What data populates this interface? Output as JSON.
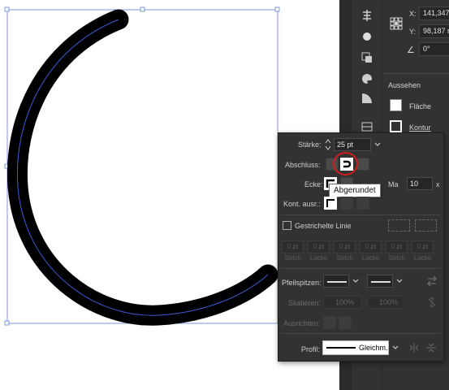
{
  "transform": {
    "x_label": "X:",
    "x_value": "141,347",
    "y_label": "Y:",
    "y_value": "98,187 r",
    "angle_value": "0°"
  },
  "appearance": {
    "title": "Aussehen",
    "fill_label": "Fläche",
    "stroke_label": "Kontur"
  },
  "stroke_panel": {
    "weight_label": "Stärke:",
    "weight_value": "25 pt",
    "cap_label": "Abschluss:",
    "corner_label": "Ecke:",
    "limit_label": "Ma",
    "limit_value": "10",
    "limit_unit": "x",
    "align_label": "Kont. ausr.:",
    "dashed_label": "Gestrichelte Linie",
    "dash_values": [
      "0 pt",
      "0 pt",
      "0 pt",
      "0 pt",
      "0 pt",
      "0 pt"
    ],
    "dash_labels": [
      "Strich",
      "Lücke",
      "Strich",
      "Lücke",
      "Strich",
      "Lücke"
    ],
    "arrowheads_label": "Pfeilspitzen:",
    "scale_label": "Skalieren:",
    "scale_start": "100%",
    "scale_end": "100%",
    "align_arrows_label": "Ausrichten:",
    "profile_label": "Profil:",
    "profile_value": "Gleichm.",
    "tooltip": "Abgerundet"
  },
  "colors": {
    "highlight": "#d11e1e",
    "path_guide": "#3b5bd9",
    "stroke": "#000000"
  }
}
